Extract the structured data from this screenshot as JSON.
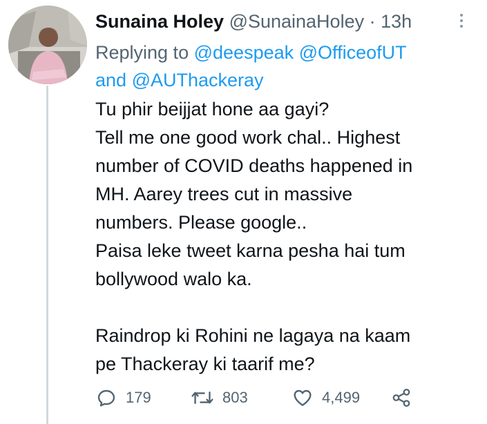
{
  "tweet": {
    "display_name": "Sunaina Holey",
    "handle": "@SunainaHoley",
    "separator": "·",
    "time": "13h",
    "replying_prefix": "Replying to",
    "mentions": [
      "@deespeak",
      "@OfficeofUT",
      "@AUThackeray"
    ],
    "mentions_joiner": "and",
    "lines": [
      "Tu phir beijjat hone aa gayi?",
      "Tell me one good work chal.. Highest",
      "number of COVID deaths happened in",
      "MH. Aarey trees cut in massive",
      "numbers. Please google..",
      "Paisa leke tweet karna pesha hai tum",
      "bollywood walo ka.",
      "",
      "Raindrop ki Rohini ne lagaya na kaam",
      "pe Thackeray ki taarif me?"
    ]
  },
  "actions": {
    "reply_icon": "reply-icon",
    "reply_count": "179",
    "retweet_icon": "retweet-icon",
    "retweet_count": "803",
    "like_icon": "heart-icon",
    "like_count": "4,499",
    "share_icon": "share-icon"
  },
  "colors": {
    "accent": "#1d9bf0",
    "text": "#0f1419",
    "muted": "#536471",
    "thread_line": "#cfd9de"
  }
}
